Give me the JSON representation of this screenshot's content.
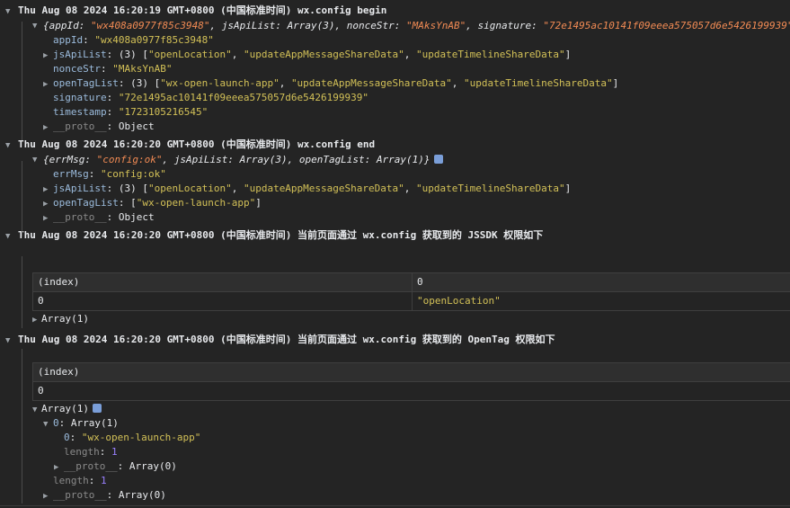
{
  "group1": {
    "header": "Thu Aug 08 2024 16:20:19 GMT+0800 (中国标准时间) wx.config begin",
    "summary_open": "{",
    "summary_k1": "appId",
    "summary_v1": "\"wx408a0977f85c3948\"",
    "summary_k2": "jsApiList",
    "summary_v2": "Array(3)",
    "summary_k3": "nonceStr",
    "summary_v3": "\"MAksYnAB\"",
    "summary_k4": "signature",
    "summary_v4": "\"72e1495ac10141f09eeea575057d6e5426199939\"",
    "appId_key": "appId",
    "appId_val": "\"wx408a0977f85c3948\"",
    "jsApiList_key": "jsApiList",
    "jsApiList_prefix": "(3) [",
    "jsApiList_items": [
      "\"openLocation\"",
      "\"updateAppMessageShareData\"",
      "\"updateTimelineShareData\""
    ],
    "nonceStr_key": "nonceStr",
    "nonceStr_val": "\"MAksYnAB\"",
    "openTagList_key": "openTagList",
    "openTagList_prefix": "(3) [",
    "openTagList_items": [
      "\"wx-open-launch-app\"",
      "\"updateAppMessageShareData\"",
      "\"updateTimelineShareData\""
    ],
    "signature_key": "signature",
    "signature_val": "\"72e1495ac10141f09eeea575057d6e5426199939\"",
    "timestamp_key": "timestamp",
    "timestamp_val": "\"1723105216545\"",
    "proto_key": "__proto__",
    "proto_val": "Object"
  },
  "group2": {
    "header": "Thu Aug 08 2024 16:20:20 GMT+0800 (中国标准时间) wx.config end",
    "summary_k1": "errMsg",
    "summary_v1": "\"config:ok\"",
    "summary_k2": "jsApiList",
    "summary_v2": "Array(3)",
    "summary_k3": "openTagList",
    "summary_v3": "Array(1)",
    "errMsg_key": "errMsg",
    "errMsg_val": "\"config:ok\"",
    "jsApiList_key": "jsApiList",
    "jsApiList_prefix": "(3) [",
    "jsApiList_items": [
      "\"openLocation\"",
      "\"updateAppMessageShareData\"",
      "\"updateTimelineShareData\""
    ],
    "openTagList_key": "openTagList",
    "openTagList_items": [
      "\"wx-open-launch-app\""
    ],
    "proto_key": "__proto__",
    "proto_val": "Object"
  },
  "group3": {
    "header": "Thu Aug 08 2024 16:20:20 GMT+0800 (中国标准时间) 当前页面通过 wx.config 获取到的 JSSDK 权限如下",
    "table_headers": [
      "(index)",
      "0"
    ],
    "table_rows": [
      [
        "0",
        "\"openLocation\""
      ]
    ],
    "array_label": "Array(1)"
  },
  "group4": {
    "header": "Thu Aug 08 2024 16:20:20 GMT+0800 (中国标准时间) 当前页面通过 wx.config 获取到的 OpenTag 权限如下",
    "table_headers": [
      "(index)"
    ],
    "table_rows": [
      [
        "0"
      ]
    ],
    "array_label": "Array(1)",
    "item0_key": "0",
    "item0_val": "Array(1)",
    "inner0_key": "0",
    "inner0_val": "\"wx-open-launch-app\"",
    "inner_length_key": "length",
    "inner_length_val": "1",
    "inner_proto_key": "__proto__",
    "inner_proto_val": "Array(0)",
    "length_key": "length",
    "length_val": "1",
    "proto_key": "__proto__",
    "proto_val": "Array(0)"
  }
}
